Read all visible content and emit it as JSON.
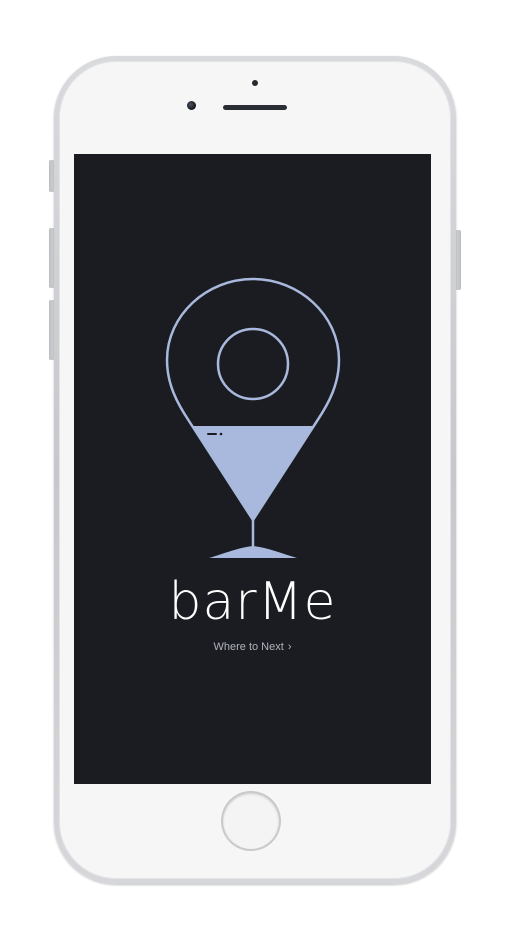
{
  "app": {
    "title": "barMe",
    "tagline": "Where to Next",
    "tagline_chevron": "›"
  },
  "icons": {
    "logo": "map-pin-cocktail-glass-icon",
    "next": "chevron-right-icon"
  },
  "colors": {
    "screen_background": "#1b1c21",
    "logo_accent": "#a8b9dd",
    "title_text": "#ffffff",
    "tagline_text": "#aeb3bd",
    "device_body": "#f6f6f6",
    "device_frame": "#c6c8cb"
  }
}
